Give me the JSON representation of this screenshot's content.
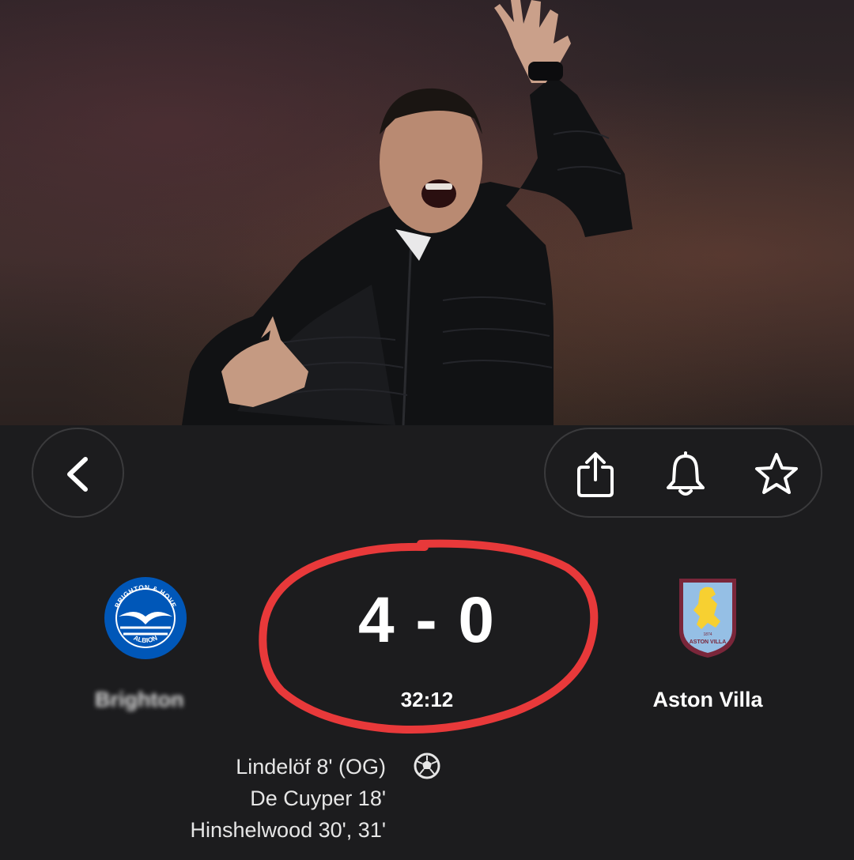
{
  "match": {
    "home_team": "Brighton",
    "away_team": "Aston Villa",
    "score": "4 - 0",
    "clock": "32:12"
  },
  "scorers": [
    "Lindelöf 8' (OG)",
    "De Cuyper 18'",
    "Hinshelwood 30', 31'"
  ],
  "home_crest_text": {
    "top": "BRIGHTON & HOVE",
    "bottom": "ALBION"
  },
  "away_crest_text": {
    "year": "1874",
    "bottom": "ASTON VILLA"
  },
  "icons": {
    "back": "chevron-left-icon",
    "share": "share-icon",
    "bell": "bell-icon",
    "star": "star-icon",
    "goal": "football-icon"
  },
  "colors": {
    "background": "#1c1c1e",
    "annotation": "#e8393a",
    "brighton_blue": "#0057b8",
    "villa_claret": "#7a263a",
    "villa_blue": "#95bfe5",
    "villa_yellow": "#f7d031"
  }
}
